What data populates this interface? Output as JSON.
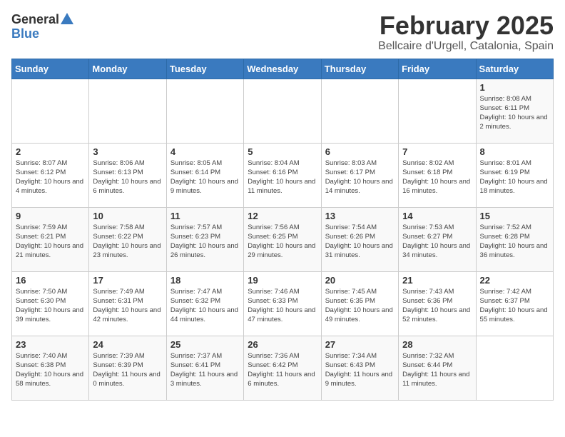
{
  "header": {
    "logo_general": "General",
    "logo_blue": "Blue",
    "title": "February 2025",
    "subtitle": "Bellcaire d'Urgell, Catalonia, Spain"
  },
  "days_of_week": [
    "Sunday",
    "Monday",
    "Tuesday",
    "Wednesday",
    "Thursday",
    "Friday",
    "Saturday"
  ],
  "weeks": [
    [
      {
        "day": "",
        "info": ""
      },
      {
        "day": "",
        "info": ""
      },
      {
        "day": "",
        "info": ""
      },
      {
        "day": "",
        "info": ""
      },
      {
        "day": "",
        "info": ""
      },
      {
        "day": "",
        "info": ""
      },
      {
        "day": "1",
        "info": "Sunrise: 8:08 AM\nSunset: 6:11 PM\nDaylight: 10 hours and 2 minutes."
      }
    ],
    [
      {
        "day": "2",
        "info": "Sunrise: 8:07 AM\nSunset: 6:12 PM\nDaylight: 10 hours and 4 minutes."
      },
      {
        "day": "3",
        "info": "Sunrise: 8:06 AM\nSunset: 6:13 PM\nDaylight: 10 hours and 6 minutes."
      },
      {
        "day": "4",
        "info": "Sunrise: 8:05 AM\nSunset: 6:14 PM\nDaylight: 10 hours and 9 minutes."
      },
      {
        "day": "5",
        "info": "Sunrise: 8:04 AM\nSunset: 6:16 PM\nDaylight: 10 hours and 11 minutes."
      },
      {
        "day": "6",
        "info": "Sunrise: 8:03 AM\nSunset: 6:17 PM\nDaylight: 10 hours and 14 minutes."
      },
      {
        "day": "7",
        "info": "Sunrise: 8:02 AM\nSunset: 6:18 PM\nDaylight: 10 hours and 16 minutes."
      },
      {
        "day": "8",
        "info": "Sunrise: 8:01 AM\nSunset: 6:19 PM\nDaylight: 10 hours and 18 minutes."
      }
    ],
    [
      {
        "day": "9",
        "info": "Sunrise: 7:59 AM\nSunset: 6:21 PM\nDaylight: 10 hours and 21 minutes."
      },
      {
        "day": "10",
        "info": "Sunrise: 7:58 AM\nSunset: 6:22 PM\nDaylight: 10 hours and 23 minutes."
      },
      {
        "day": "11",
        "info": "Sunrise: 7:57 AM\nSunset: 6:23 PM\nDaylight: 10 hours and 26 minutes."
      },
      {
        "day": "12",
        "info": "Sunrise: 7:56 AM\nSunset: 6:25 PM\nDaylight: 10 hours and 29 minutes."
      },
      {
        "day": "13",
        "info": "Sunrise: 7:54 AM\nSunset: 6:26 PM\nDaylight: 10 hours and 31 minutes."
      },
      {
        "day": "14",
        "info": "Sunrise: 7:53 AM\nSunset: 6:27 PM\nDaylight: 10 hours and 34 minutes."
      },
      {
        "day": "15",
        "info": "Sunrise: 7:52 AM\nSunset: 6:28 PM\nDaylight: 10 hours and 36 minutes."
      }
    ],
    [
      {
        "day": "16",
        "info": "Sunrise: 7:50 AM\nSunset: 6:30 PM\nDaylight: 10 hours and 39 minutes."
      },
      {
        "day": "17",
        "info": "Sunrise: 7:49 AM\nSunset: 6:31 PM\nDaylight: 10 hours and 42 minutes."
      },
      {
        "day": "18",
        "info": "Sunrise: 7:47 AM\nSunset: 6:32 PM\nDaylight: 10 hours and 44 minutes."
      },
      {
        "day": "19",
        "info": "Sunrise: 7:46 AM\nSunset: 6:33 PM\nDaylight: 10 hours and 47 minutes."
      },
      {
        "day": "20",
        "info": "Sunrise: 7:45 AM\nSunset: 6:35 PM\nDaylight: 10 hours and 49 minutes."
      },
      {
        "day": "21",
        "info": "Sunrise: 7:43 AM\nSunset: 6:36 PM\nDaylight: 10 hours and 52 minutes."
      },
      {
        "day": "22",
        "info": "Sunrise: 7:42 AM\nSunset: 6:37 PM\nDaylight: 10 hours and 55 minutes."
      }
    ],
    [
      {
        "day": "23",
        "info": "Sunrise: 7:40 AM\nSunset: 6:38 PM\nDaylight: 10 hours and 58 minutes."
      },
      {
        "day": "24",
        "info": "Sunrise: 7:39 AM\nSunset: 6:39 PM\nDaylight: 11 hours and 0 minutes."
      },
      {
        "day": "25",
        "info": "Sunrise: 7:37 AM\nSunset: 6:41 PM\nDaylight: 11 hours and 3 minutes."
      },
      {
        "day": "26",
        "info": "Sunrise: 7:36 AM\nSunset: 6:42 PM\nDaylight: 11 hours and 6 minutes."
      },
      {
        "day": "27",
        "info": "Sunrise: 7:34 AM\nSunset: 6:43 PM\nDaylight: 11 hours and 9 minutes."
      },
      {
        "day": "28",
        "info": "Sunrise: 7:32 AM\nSunset: 6:44 PM\nDaylight: 11 hours and 11 minutes."
      },
      {
        "day": "",
        "info": ""
      }
    ]
  ]
}
